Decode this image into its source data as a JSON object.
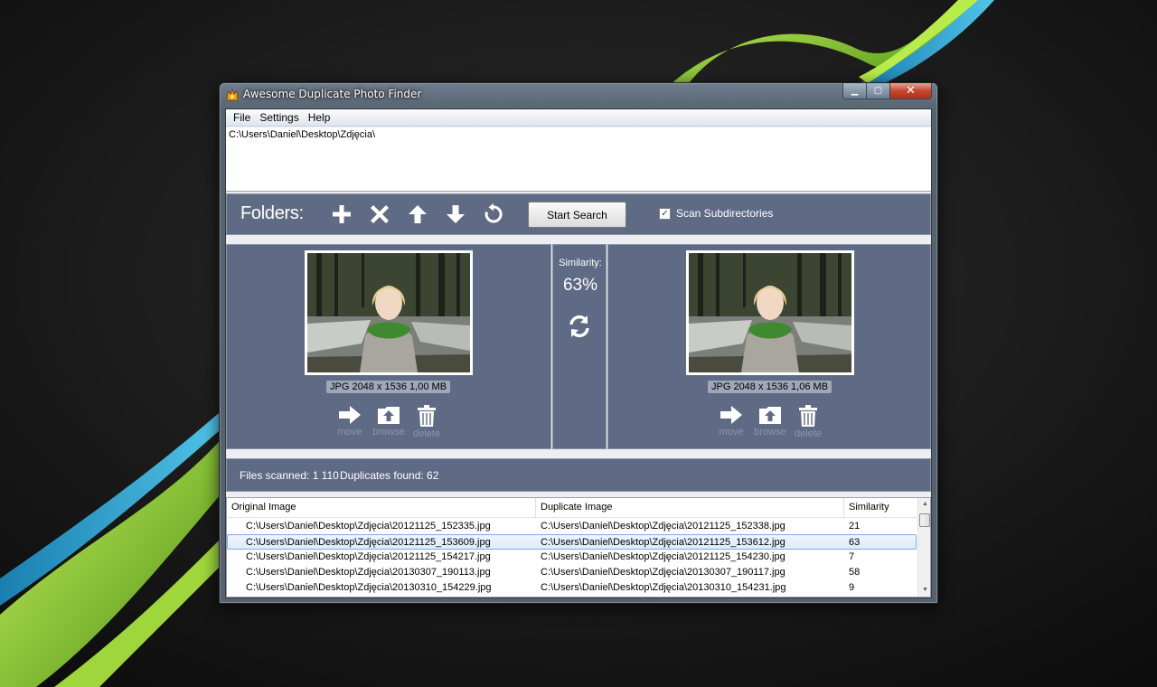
{
  "window": {
    "title": "Awesome Duplicate Photo Finder",
    "minimize_glyph": "▁",
    "maximize_glyph": "▢",
    "close_glyph": "✕"
  },
  "menu": [
    "File",
    "Settings",
    "Help"
  ],
  "folders": {
    "paths": "C:\\Users\\Daniel\\Desktop\\Zdjęcia\\",
    "label": "Folders:",
    "tools": [
      "add-icon",
      "remove-icon",
      "move-up-icon",
      "move-down-icon",
      "reset-icon"
    ],
    "start_button": "Start Search",
    "scan_subdirectories": {
      "label": "Scan Subdirectories",
      "checked": true,
      "glyph": "✓"
    }
  },
  "compare": {
    "left": {
      "info": "JPG  2048 x 1536  1,00 MB",
      "actions": {
        "move": "move",
        "browse": "browse",
        "delete": "delete"
      }
    },
    "similarity_label": "Similarity:",
    "similarity_value": "63%",
    "right": {
      "info": "JPG  2048 x 1536  1,06 MB",
      "actions": {
        "move": "move",
        "browse": "browse",
        "delete": "delete"
      }
    }
  },
  "status": {
    "files_scanned": "Files scanned: 1 110",
    "duplicates_found": "Duplicates found: 62"
  },
  "results": {
    "columns": [
      "Original Image",
      "Duplicate Image",
      "Similarity"
    ],
    "rows": [
      {
        "original": "C:\\Users\\Daniel\\Desktop\\Zdjęcia\\20121125_152335.jpg",
        "duplicate": "C:\\Users\\Daniel\\Desktop\\Zdjęcia\\20121125_152338.jpg",
        "similarity": "21",
        "selected": false
      },
      {
        "original": "C:\\Users\\Daniel\\Desktop\\Zdjęcia\\20121125_153609.jpg",
        "duplicate": "C:\\Users\\Daniel\\Desktop\\Zdjęcia\\20121125_153612.jpg",
        "similarity": "63",
        "selected": true
      },
      {
        "original": "C:\\Users\\Daniel\\Desktop\\Zdjęcia\\20121125_154217.jpg",
        "duplicate": "C:\\Users\\Daniel\\Desktop\\Zdjęcia\\20121125_154230.jpg",
        "similarity": "7",
        "selected": false
      },
      {
        "original": "C:\\Users\\Daniel\\Desktop\\Zdjęcia\\20130307_190113.jpg",
        "duplicate": "C:\\Users\\Daniel\\Desktop\\Zdjęcia\\20130307_190117.jpg",
        "similarity": "58",
        "selected": false
      },
      {
        "original": "C:\\Users\\Daniel\\Desktop\\Zdjęcia\\20130310_154229.jpg",
        "duplicate": "C:\\Users\\Daniel\\Desktop\\Zdjęcia\\20130310_154231.jpg",
        "similarity": "9",
        "selected": false
      }
    ],
    "scroll_up_glyph": "▲",
    "scroll_down_glyph": "▼"
  },
  "colors": {
    "panel": "#5f6a84",
    "selection": "#dcebfc",
    "wallpaper_green": "#8fc63c",
    "wallpaper_blue": "#2e9fd0"
  }
}
